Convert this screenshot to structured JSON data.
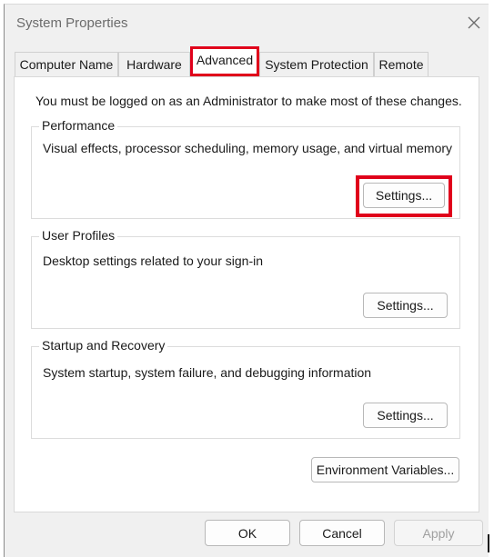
{
  "window": {
    "title": "System Properties",
    "close_icon": "close-icon"
  },
  "tabs": [
    {
      "label": "Computer Name",
      "active": false
    },
    {
      "label": "Hardware",
      "active": false
    },
    {
      "label": "Advanced",
      "active": true
    },
    {
      "label": "System Protection",
      "active": false
    },
    {
      "label": "Remote",
      "active": false
    }
  ],
  "panel": {
    "admin_note": "You must be logged on as an Administrator to make most of these changes."
  },
  "groups": {
    "performance": {
      "legend": "Performance",
      "description": "Visual effects, processor scheduling, memory usage, and virtual memory",
      "button": "Settings..."
    },
    "user_profiles": {
      "legend": "User Profiles",
      "description": "Desktop settings related to your sign-in",
      "button": "Settings..."
    },
    "startup_recovery": {
      "legend": "Startup and Recovery",
      "description": "System startup, system failure, and debugging information",
      "button": "Settings..."
    }
  },
  "environment_button": "Environment Variables...",
  "footer": {
    "ok": "OK",
    "cancel": "Cancel",
    "apply": "Apply"
  },
  "colors": {
    "highlight": "#e0001b",
    "dialog_bg": "#f0f0f0",
    "panel_bg": "#ffffff"
  }
}
